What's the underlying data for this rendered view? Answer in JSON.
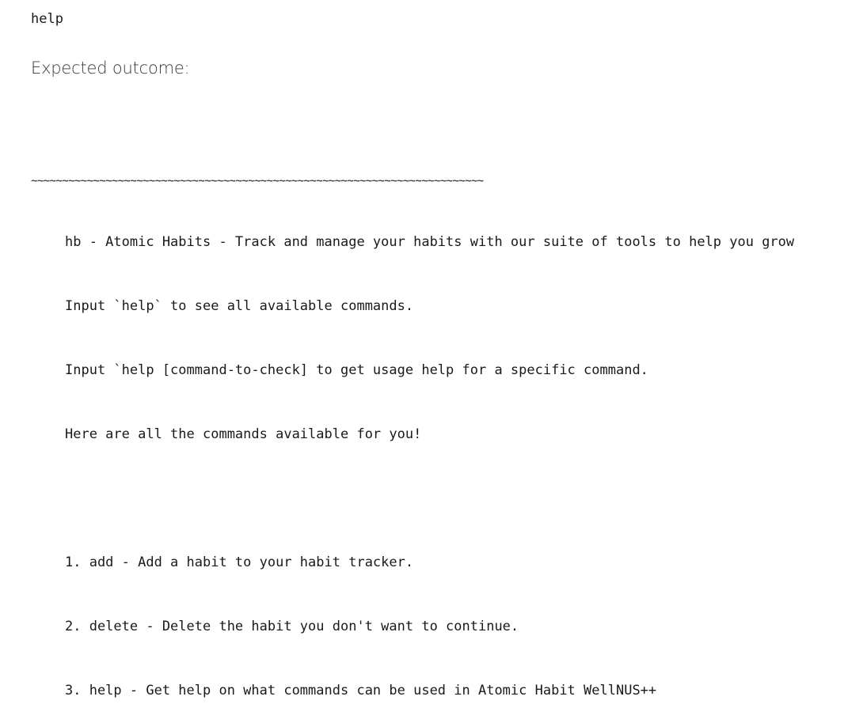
{
  "command": {
    "input": "help"
  },
  "expected": {
    "heading": "Expected outcome:"
  },
  "output": {
    "divider": "~~~~~~~~~~~~~~~~~~~~~~~~~~~~~~~~~~~~~~~~~~~~~~~~~~~~~~~~~~~~~~~~~~~~~~~~~",
    "intro_lines": [
      "hb - Atomic Habits - Track and manage your habits with our suite of tools to help you grow",
      "Input `help` to see all available commands.",
      "Input `help [command-to-check] to get usage help for a specific command.",
      "Here are all the commands available for you!"
    ],
    "commands": [
      "1. add - Add a habit to your habit tracker.",
      "2. delete - Delete the habit you don't want to continue.",
      "3. help - Get help on what commands can be used in Atomic Habit WellNUS++"
    ]
  }
}
